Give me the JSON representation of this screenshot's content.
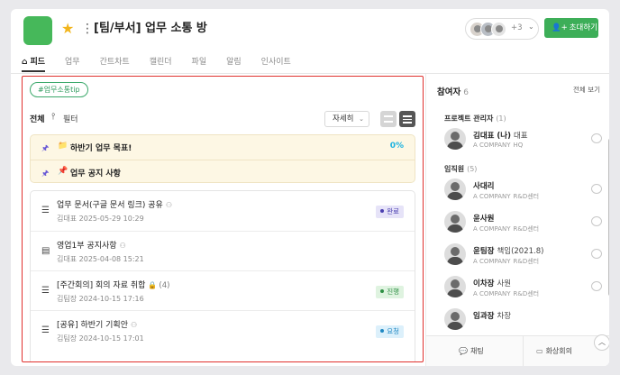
{
  "header": {
    "title": "[팀/부서] 업무 소통 방",
    "member_more": "+3",
    "invite_label": "초대하기"
  },
  "tabs": [
    {
      "label": "피드",
      "active": true
    },
    {
      "label": "업무"
    },
    {
      "label": "간트차트"
    },
    {
      "label": "캘린더"
    },
    {
      "label": "파일"
    },
    {
      "label": "알림"
    },
    {
      "label": "인사이트"
    }
  ],
  "feed": {
    "hashtag": "#업무소통tip",
    "filter_all": "전체",
    "filter_label": "필터",
    "view_select": "자세히",
    "notices": [
      {
        "emoji": "📁",
        "text": "하반기 업무 목표!",
        "percent": "0%"
      },
      {
        "emoji": "📌",
        "text": "업무 공지 사항"
      }
    ],
    "posts": [
      {
        "title": "업무 문서(구글 문서 링크) 공유",
        "author": "김대표",
        "date": "2025-05-29 10:29",
        "status": "완료"
      },
      {
        "title": "영업1부 공지사항",
        "author": "김대표",
        "date": "2025-04-08 15:21"
      },
      {
        "title": "[주간회의] 회의 자료 취합",
        "count": "(4)",
        "author": "김팀장",
        "date": "2024-10-15 17:16",
        "status": "진행"
      },
      {
        "title": "[공유] 하반기 기획안",
        "author": "김팀장",
        "date": "2024-10-15 17:01",
        "status": "요청"
      }
    ]
  },
  "panel": {
    "title": "참여자",
    "count": "6",
    "view_all": "전체 보기",
    "sections": [
      {
        "label": "프로젝트 관리자",
        "count": "(1)"
      },
      {
        "label": "임직원",
        "count": "(5)"
      }
    ],
    "members": [
      {
        "name": "김대표 (나)",
        "role": "대표",
        "org": "A COMPANY",
        "dept": "HQ"
      },
      {
        "name": "사대리",
        "org": "A COMPANY",
        "dept": "R&D센터"
      },
      {
        "name": "윤사원",
        "org": "A COMPANY",
        "dept": "R&D센터"
      },
      {
        "name": "윤팀장",
        "role": "책임(2021.8)",
        "org": "A COMPANY",
        "dept": "R&D센터"
      },
      {
        "name": "이차장",
        "role": "사원",
        "org": "A COMPANY",
        "dept": "R&D센터"
      },
      {
        "name": "임과장",
        "role": "차장"
      }
    ],
    "footer_chat": "채팅",
    "footer_video": "화상회의"
  },
  "colors": {
    "brand_green": "#3dae58",
    "highlight_red": "#e0312e",
    "progress_blue": "#1eb3e0"
  }
}
